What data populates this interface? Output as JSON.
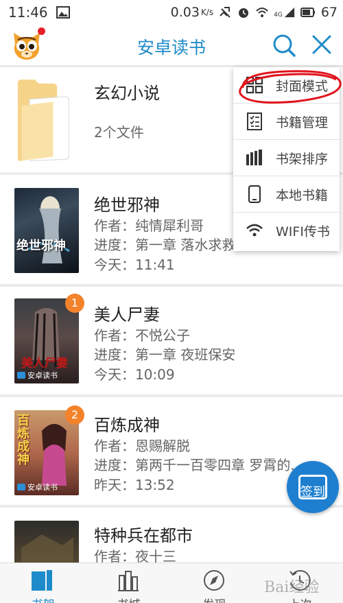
{
  "status_bar": {
    "time": "11:46",
    "net_speed": "0.03",
    "net_unit": "K/s",
    "battery": "67",
    "signal": "4G"
  },
  "header": {
    "title": "安卓读书",
    "avatar_icon": "tiger-cat-avatar-icon",
    "search_icon": "search-icon",
    "close_icon": "close-icon"
  },
  "folder": {
    "name": "玄幻小说",
    "count": "2个文件"
  },
  "books": [
    {
      "title": "绝世邪神",
      "author": "作者：纯情犀利哥",
      "progress": "进度：第一章 落水求救",
      "time": "今天：11:41",
      "badge": "",
      "cover_text": "绝世邪神"
    },
    {
      "title": "美人尸妻",
      "author": "作者：不悦公子",
      "progress": "进度：第一章 夜班保安",
      "time": "今天：10:09",
      "badge": "1",
      "cover_text": "美人尸妻"
    },
    {
      "title": "百炼成神",
      "author": "作者：恩赐解脱",
      "progress": "进度：第两千一百零四章 罗霄的.",
      "time": "昨天：13:52",
      "badge": "2",
      "cover_text": "百炼成神"
    },
    {
      "title": "特种兵在都市",
      "author": "作者：夜十三",
      "progress": "",
      "time": "",
      "badge": "",
      "cover_text": ""
    }
  ],
  "cover_brand": "安卓读书",
  "menu": [
    {
      "label": "封面模式",
      "icon": "grid-icon"
    },
    {
      "label": "书籍管理",
      "icon": "checklist-icon"
    },
    {
      "label": "书架排序",
      "icon": "sort-bars-icon"
    },
    {
      "label": "本地书籍",
      "icon": "phone-icon"
    },
    {
      "label": "WIFI传书",
      "icon": "wifi-icon"
    }
  ],
  "sign_in": {
    "label": "签到",
    "icon": "calendar-icon"
  },
  "bottom_nav": [
    {
      "label": "书架",
      "icon": "bookshelf-icon",
      "active": true
    },
    {
      "label": "书城",
      "icon": "bookstore-icon",
      "active": false
    },
    {
      "label": "发现",
      "icon": "compass-icon",
      "active": false
    },
    {
      "label": "上次",
      "icon": "history-icon",
      "active": false
    }
  ],
  "watermark": "Bai经验",
  "colors": {
    "accent": "#1d8bc9",
    "badge": "#f3822b",
    "sign_in": "#1e7fd0",
    "annotation": "#e0121b"
  }
}
